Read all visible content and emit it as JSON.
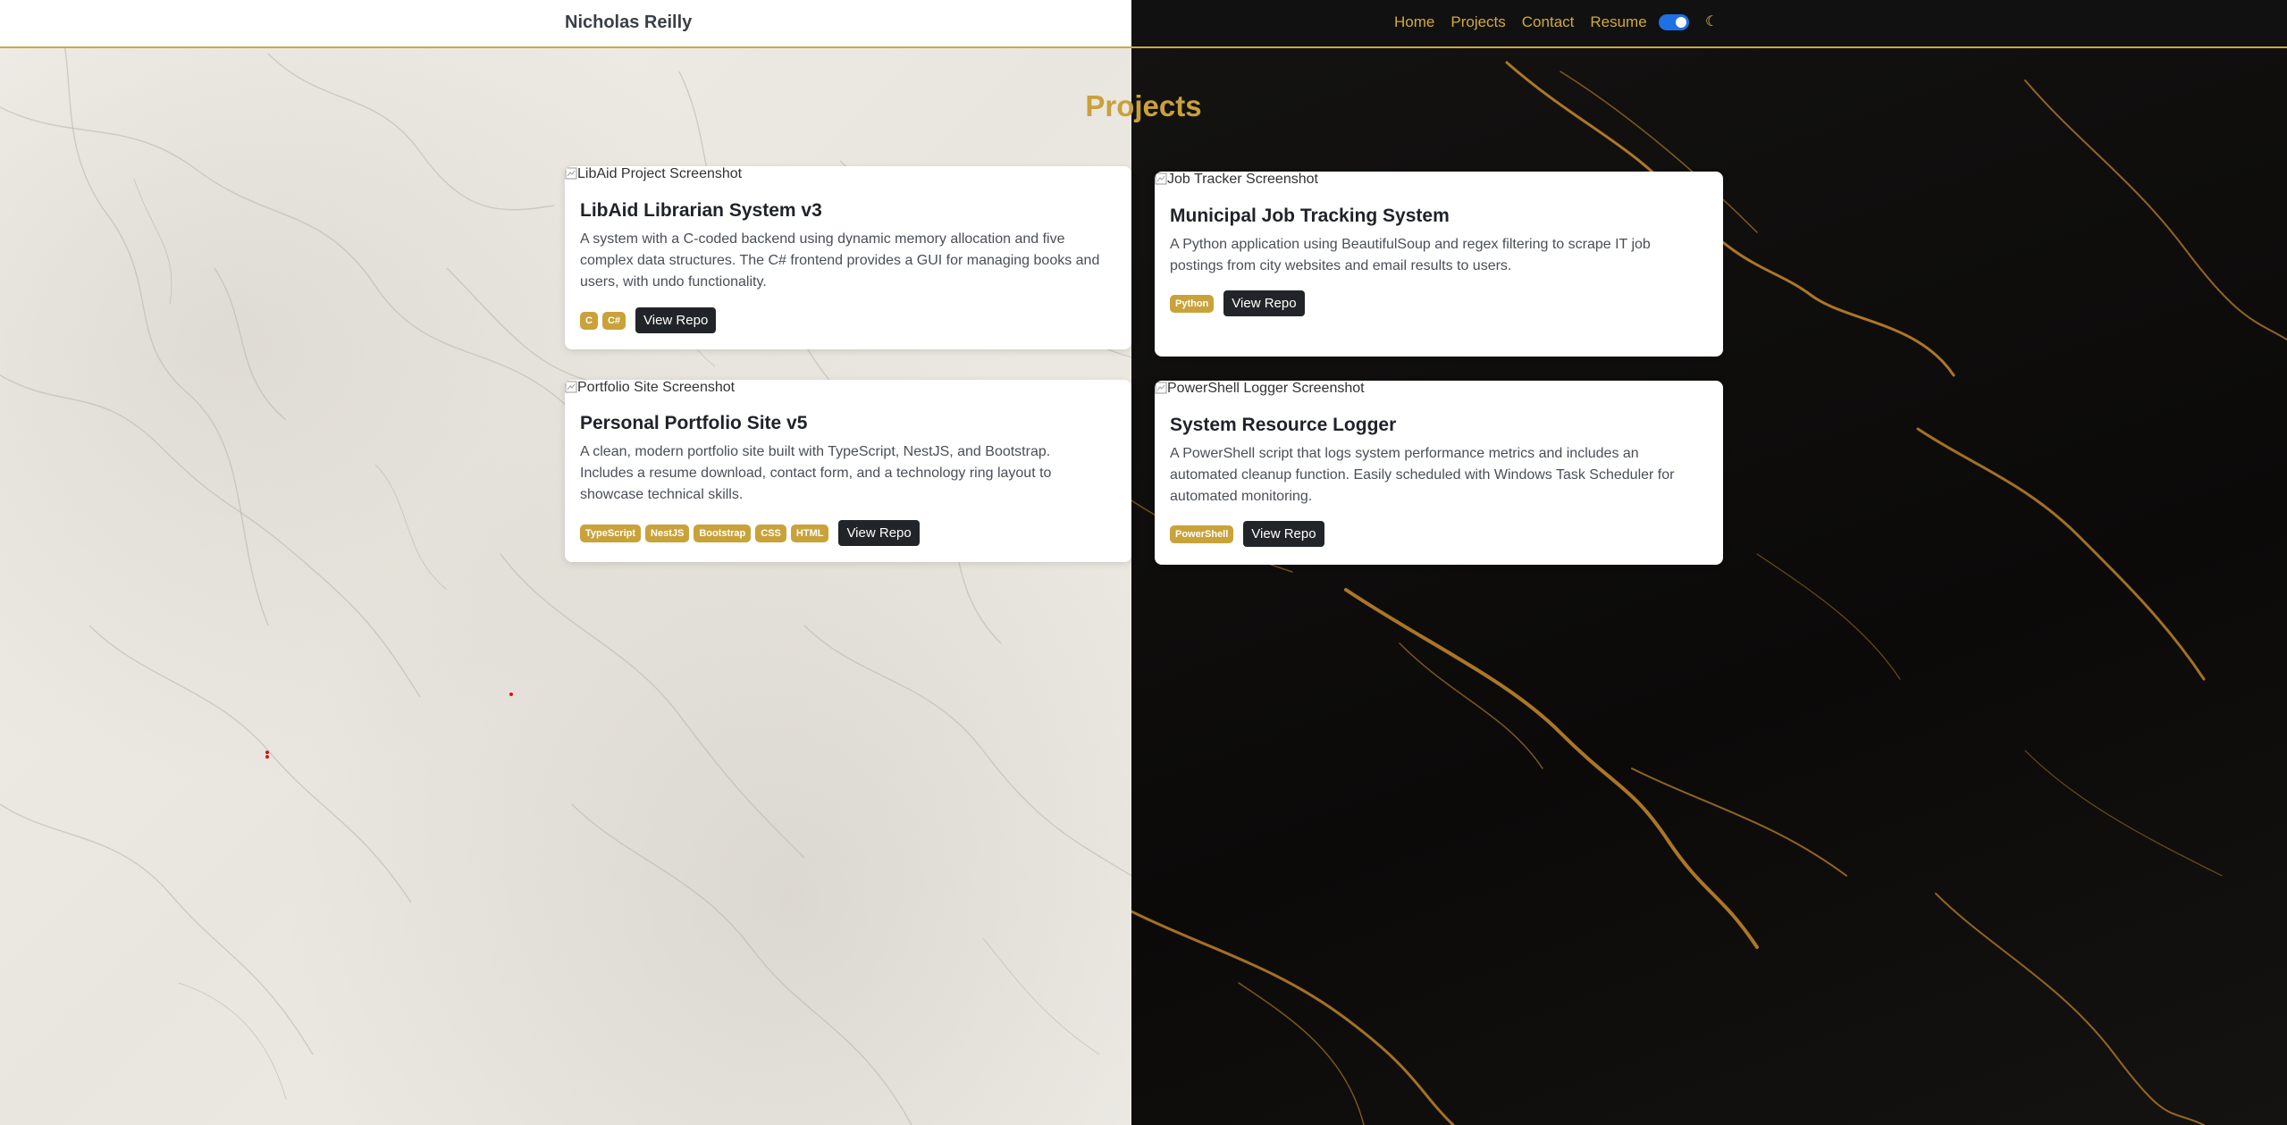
{
  "navbar": {
    "brand": "Nicholas Reilly",
    "links": [
      "Home",
      "Projects",
      "Contact",
      "Resume"
    ],
    "theme_icon": "moon-icon",
    "theme_toggle_on": true
  },
  "section": {
    "title": "Projects"
  },
  "projects": [
    {
      "image_alt": "LibAid Project Screenshot",
      "title": "LibAid Librarian System v3",
      "description": "A system with a C-coded backend using dynamic memory allocation and five complex data structures. The C# frontend provides a GUI for managing books and users, with undo functionality.",
      "tags": [
        "C",
        "C#"
      ],
      "button": "View Repo"
    },
    {
      "image_alt": "Job Tracker Screenshot",
      "title": "Municipal Job Tracking System",
      "description": "A Python application using BeautifulSoup and regex filtering to scrape IT job postings from city websites and email results to users.",
      "tags": [
        "Python"
      ],
      "button": "View Repo"
    },
    {
      "image_alt": "Portfolio Site Screenshot",
      "title": "Personal Portfolio Site v5",
      "description": "A clean, modern portfolio site built with TypeScript, NestJS, and Bootstrap. Includes a resume download, contact form, and a technology ring layout to showcase technical skills.",
      "tags": [
        "TypeScript",
        "NestJS",
        "Bootstrap",
        "CSS",
        "HTML"
      ],
      "button": "View Repo"
    },
    {
      "image_alt": "PowerShell Logger Screenshot",
      "title": "System Resource Logger",
      "description": "A PowerShell script that logs system performance metrics and includes an automated cleanup function. Easily scheduled with Windows Task Scheduler for automated monitoring.",
      "tags": [
        "PowerShell"
      ],
      "button": "View Repo"
    }
  ],
  "colors": {
    "accent_gold": "#c9a23a",
    "nav_link": "#d4a93a",
    "button_dark": "#212529",
    "toggle_blue": "#1f6fe5"
  }
}
